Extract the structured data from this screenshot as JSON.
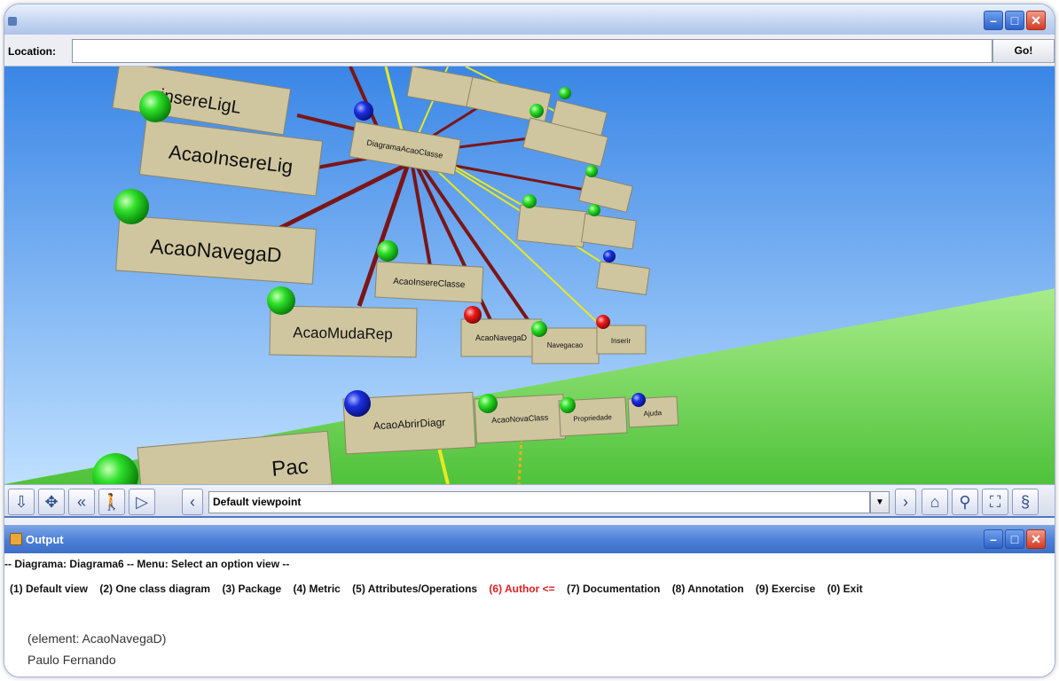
{
  "window": {
    "title": ""
  },
  "location": {
    "label": "Location:",
    "value": "",
    "go_label": "Go!"
  },
  "scene": {
    "nodes": [
      {
        "label": "insereLigL",
        "color": "green"
      },
      {
        "label": "AcaoInsereLig",
        "color": "green"
      },
      {
        "label": "AcaoNavegaD",
        "color": "green"
      },
      {
        "label": "AcaoMudaRep",
        "color": "green"
      },
      {
        "label": "DiagramaAcaoClasse",
        "color": "blue"
      },
      {
        "label": "AcaoInsereClasse",
        "color": "green"
      },
      {
        "label": "AcaoNavegaD",
        "color": "red"
      },
      {
        "label": "Navegacao",
        "color": "green"
      },
      {
        "label": "Inserir",
        "color": "red"
      },
      {
        "label": "AcaoAbrirDiagr",
        "color": "blue"
      },
      {
        "label": "AcaoNovaClass",
        "color": "green"
      },
      {
        "label": "Propriedade",
        "color": "green"
      },
      {
        "label": "Ajuda",
        "color": "blue"
      },
      {
        "label": "Pac",
        "color": "green"
      }
    ]
  },
  "navigation": {
    "viewpoint": "Default viewpoint",
    "buttons": [
      "down-arrow-icon",
      "pan-icon",
      "rotate-left-icon",
      "walk-icon",
      "fly-icon"
    ],
    "prev_icon": "chevron-left-icon",
    "next_icon": "chevron-right-icon",
    "right_icons": [
      "home-icon",
      "binoculars-icon",
      "fit-icon",
      "seek-icon"
    ]
  },
  "output": {
    "title": "Output",
    "header_line": "-- Diagrama: Diagrama6 -- Menu: Select an option view --",
    "menu_items": [
      {
        "label": "(1) Default view",
        "active": false
      },
      {
        "label": "(2) One class diagram",
        "active": false
      },
      {
        "label": "(3) Package",
        "active": false
      },
      {
        "label": "(4) Metric",
        "active": false
      },
      {
        "label": "(5) Attributes/Operations",
        "active": false
      },
      {
        "label": "(6) Author <=",
        "active": true
      },
      {
        "label": "(7) Documentation",
        "active": false
      },
      {
        "label": "(8) Annotation",
        "active": false
      },
      {
        "label": "(9) Exercise",
        "active": false
      },
      {
        "label": "(0) Exit",
        "active": false
      }
    ],
    "element_line": "(element: AcaoNavegaD)",
    "author_line": "Paulo Fernando"
  },
  "colors": {
    "sky_top": "#3a86e6",
    "sky_bottom": "#bfe0ff",
    "ground": "#6fd34a",
    "edge_dark": "#7a1616",
    "edge_yellow": "#e8e820",
    "node_face": "#cfc6a0",
    "active_menu": "#e02020"
  }
}
